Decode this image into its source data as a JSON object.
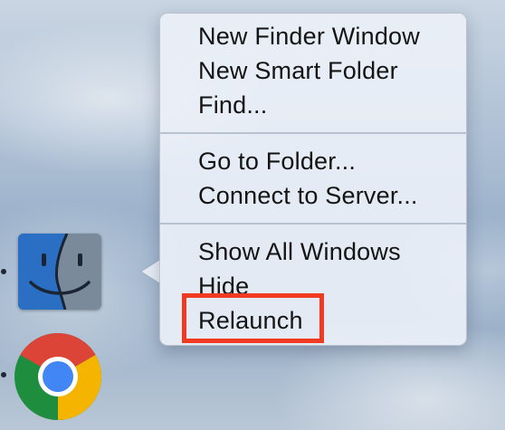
{
  "dock": {
    "apps": [
      {
        "name": "Finder",
        "icon": "finder-icon"
      },
      {
        "name": "Google Chrome",
        "icon": "chrome-icon"
      }
    ]
  },
  "context_menu": {
    "groups": [
      {
        "items": [
          {
            "label": "New Finder Window"
          },
          {
            "label": "New Smart Folder"
          },
          {
            "label": "Find..."
          }
        ]
      },
      {
        "items": [
          {
            "label": "Go to Folder..."
          },
          {
            "label": "Connect to Server..."
          }
        ]
      },
      {
        "items": [
          {
            "label": "Show All Windows"
          },
          {
            "label": "Hide"
          },
          {
            "label": "Relaunch"
          }
        ]
      }
    ]
  },
  "annotation": {
    "highlight_color": "#f03a22",
    "highlighted_item": "Relaunch"
  }
}
